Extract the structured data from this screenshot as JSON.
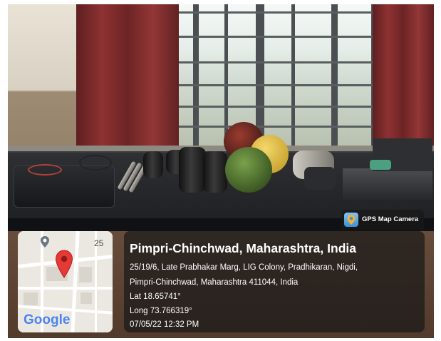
{
  "overlay": {
    "badge_label": "GPS Map Camera",
    "title": "Pimpri-Chinchwad, Maharashtra, India",
    "address_line_1": "25/19/6, Late Prabhakar Marg, LIG Colony, Pradhikaran, Nigdi,",
    "address_line_2": "Pimpri-Chinchwad, Maharashtra 411044, India",
    "latitude": "Lat 18.65741°",
    "longitude": "Long 73.766319°",
    "datetime": "07/05/22 12:32 PM"
  },
  "map": {
    "street_number": "25",
    "logo": "Google",
    "pin_color": "#e53935"
  },
  "icons": [
    "map-pin-icon",
    "map-marker-icon",
    "gps-camera-icon"
  ]
}
